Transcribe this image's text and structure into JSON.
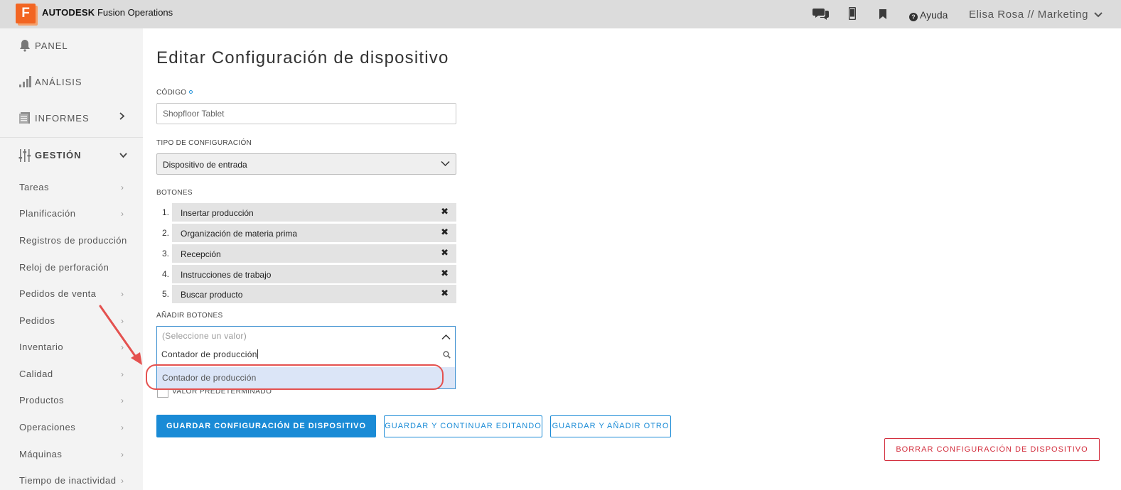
{
  "header": {
    "logo_letter": "F",
    "brand_bold": "AUTODESK",
    "brand_rest": "Fusion Operations",
    "help_label": "Ayuda",
    "user_label": "Elisa Rosa // Marketing",
    "icons": [
      "chat-icon",
      "mobile-icon",
      "bookmark-icon",
      "help-icon",
      "chevron-down-icon"
    ]
  },
  "sidebar": {
    "main": [
      {
        "label": "PANEL",
        "icon": "bell-icon"
      },
      {
        "label": "ANÁLISIS",
        "icon": "bar-chart-icon"
      },
      {
        "label": "INFORMES",
        "icon": "report-icon"
      },
      {
        "label": "GESTIÓN",
        "icon": "sliders-icon"
      }
    ],
    "sub": [
      "Tareas",
      "Planificación",
      "Registros de producción",
      "Reloj de perforación",
      "Pedidos de venta",
      "Pedidos",
      "Inventario",
      "Calidad",
      "Productos",
      "Operaciones",
      "Máquinas",
      "Tiempo de inactividad"
    ]
  },
  "form": {
    "title": "Editar Configuración de dispositivo",
    "code_label": "CÓDIGO",
    "code_value": "Shopfloor Tablet",
    "type_label": "TIPO DE CONFIGURACIÓN",
    "type_value": "Dispositivo de entrada",
    "buttons_label": "BOTONES",
    "buttons": [
      {
        "num": "1.",
        "label": "Insertar producción"
      },
      {
        "num": "2.",
        "label": "Organización de materia prima"
      },
      {
        "num": "3.",
        "label": "Recepción"
      },
      {
        "num": "4.",
        "label": "Instrucciones de trabajo"
      },
      {
        "num": "5.",
        "label": "Buscar producto"
      }
    ],
    "remove_glyph": "✖",
    "add_buttons_label": "AÑADIR BOTONES",
    "add_placeholder": "(Seleccione un valor)",
    "search_value": "Contador de producción",
    "option": "Contador de producción",
    "default_label": "VALOR PREDETERMINADO"
  },
  "actions": {
    "save": "GUARDAR CONFIGURACIÓN DE DISPOSITIVO",
    "save_continue": "GUARDAR Y CONTINUAR EDITANDO",
    "save_add": "GUARDAR Y AÑADIR OTRO",
    "delete": "BORRAR CONFIGURACIÓN DE DISPOSITIVO"
  },
  "colors": {
    "accent": "#1a8bd6",
    "danger": "#d32f3e",
    "brand": "#f26522",
    "annotation": "#e4514f"
  }
}
